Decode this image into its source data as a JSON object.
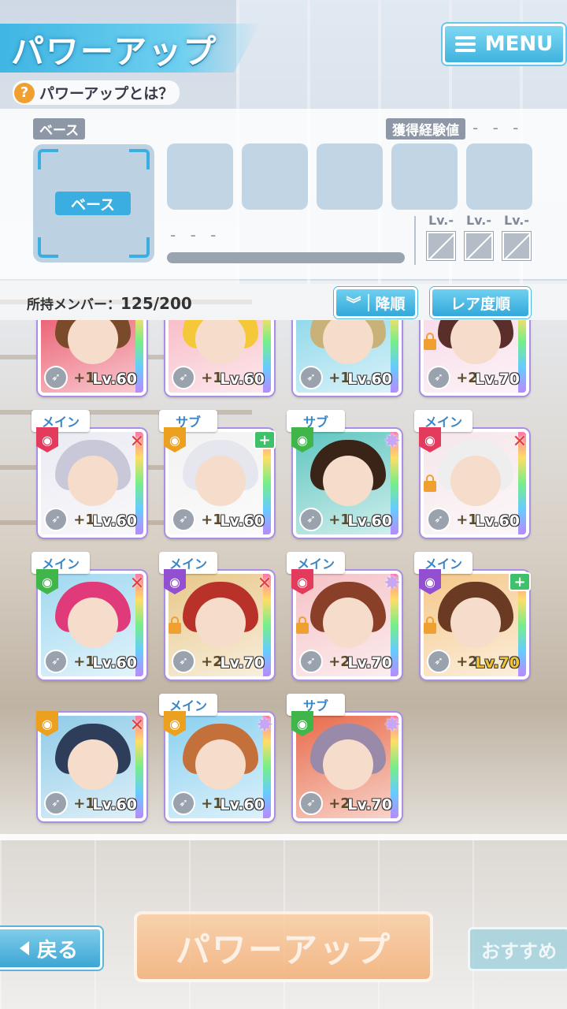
{
  "header": {
    "title": "パワーアップ",
    "menu_label": "MENU",
    "help_label": "パワーアップとは？",
    "help_mark": "?"
  },
  "base_panel": {
    "base_tag": "ベース",
    "base_slot_label": "ベース",
    "exp_tag": "獲得経験値",
    "exp_value": "- - -",
    "name_placeholder": "- - -",
    "lv_labels": [
      "Lv.-",
      "Lv.-",
      "Lv.-"
    ]
  },
  "list": {
    "members_label": "所持メンバー：",
    "members_count": "125/200",
    "sort_order_label": "降順",
    "sort_key_label": "レア度順"
  },
  "cards": [
    {
      "role": "",
      "attr": "",
      "mark": "",
      "plus": "+1",
      "lv": "Lv.60",
      "lock": false,
      "hair": "#7a4a2a",
      "bg": "#e84a5f"
    },
    {
      "role": "",
      "attr": "",
      "mark": "",
      "plus": "+1",
      "lv": "Lv.60",
      "lock": false,
      "hair": "#f5c83a",
      "bg": "#f7b3c0"
    },
    {
      "role": "",
      "attr": "",
      "mark": "",
      "plus": "+1",
      "lv": "Lv.60",
      "lock": false,
      "hair": "#c8b27a",
      "bg": "#7fd3e8"
    },
    {
      "role": "",
      "attr": "",
      "mark": "",
      "plus": "+2",
      "lv": "Lv.70",
      "lock": true,
      "hair": "#5a2e2a",
      "bg": "#f7d6e6"
    },
    {
      "role": "メイン",
      "attr": "red",
      "mark": "x",
      "plus": "+1",
      "lv": "Lv.60",
      "lock": false,
      "hair": "#c8c8d8",
      "bg": "#eaeaf2"
    },
    {
      "role": "サブ",
      "attr": "orange",
      "mark": "heal",
      "plus": "+1",
      "lv": "Lv.60",
      "lock": false,
      "hair": "#e6e6ee",
      "bg": "#f2f2f2"
    },
    {
      "role": "サブ",
      "attr": "green",
      "mark": "star",
      "plus": "+1",
      "lv": "Lv.60",
      "lock": false,
      "hair": "#3a2418",
      "bg": "#5fc6c0"
    },
    {
      "role": "メイン",
      "attr": "red",
      "mark": "x",
      "plus": "+1",
      "lv": "Lv.60",
      "lock": true,
      "hair": "#eeeeee",
      "bg": "#f5e6ea"
    },
    {
      "role": "メイン",
      "attr": "green",
      "mark": "x",
      "plus": "+1",
      "lv": "Lv.60",
      "lock": false,
      "hair": "#e03a7a",
      "bg": "#9fd8f0"
    },
    {
      "role": "メイン",
      "attr": "purple",
      "mark": "x",
      "plus": "+2",
      "lv": "Lv.70",
      "lock": true,
      "hair": "#b8322a",
      "bg": "#e8c88a"
    },
    {
      "role": "メイン",
      "attr": "red",
      "mark": "star",
      "plus": "+2",
      "lv": "Lv.70",
      "lock": true,
      "hair": "#8a4028",
      "bg": "#f5c2c6"
    },
    {
      "role": "メイン",
      "attr": "purple",
      "mark": "heal",
      "plus": "+2",
      "lv": "Lv.70",
      "lock": true,
      "hair": "#6a3a22",
      "bg": "#f4c88a",
      "gold": true
    },
    {
      "role": "",
      "attr": "orange",
      "mark": "x",
      "plus": "+1",
      "lv": "Lv.60",
      "lock": false,
      "hair": "#2e3e5a",
      "bg": "#8fcbe8"
    },
    {
      "role": "メイン",
      "attr": "orange",
      "mark": "star",
      "plus": "+1",
      "lv": "Lv.60",
      "lock": false,
      "hair": "#c4703a",
      "bg": "#8ad0f0"
    },
    {
      "role": "サブ",
      "attr": "green",
      "mark": "star",
      "plus": "+2",
      "lv": "Lv.70",
      "lock": false,
      "hair": "#9a8aaa",
      "bg": "#e86a4a"
    }
  ],
  "footer": {
    "back_label": "戻る",
    "power_up_label": "パワーアップ",
    "recommend_label": "おすすめ"
  },
  "icons": {
    "menu": "hamburger-icon",
    "help": "question-icon",
    "sort": "chevrons-down-icon",
    "weapon": "weapon-icon",
    "plus": "star-plus-icon",
    "attr": "attribute-icon",
    "back": "triangle-left-icon",
    "slash": "empty-slot-icon"
  },
  "colors": {
    "accent": "#3fb6e3",
    "power_button": "#f4aa6e",
    "role_text": "#3a86c6"
  }
}
